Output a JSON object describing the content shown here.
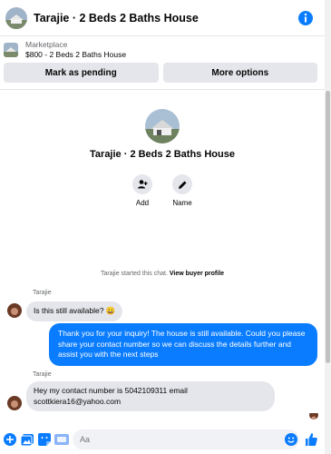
{
  "header": {
    "title": "Tarajie · 2 Beds 2 Baths House"
  },
  "listing": {
    "label": "Marketplace",
    "title": "$800 - 2 Beds 2 Baths House"
  },
  "actions": {
    "pending_label": "Mark as pending",
    "more_label": "More options"
  },
  "profile": {
    "title": "Tarajie · 2 Beds 2 Baths House",
    "add_label": "Add",
    "name_label": "Name"
  },
  "chat": {
    "started_prefix": "Tarajie started this chat.",
    "view_profile": "View buyer profile",
    "messages": [
      {
        "sender": "Tarajie",
        "text": "Is this still available? 😀"
      },
      {
        "sender": "",
        "text": "Thank you for your inquiry! The house is still available. Could you please share your contact number so we can discuss the details further and assist you with the next steps"
      },
      {
        "sender": "Tarajie",
        "text": "Hey my contact number is 5042109311 email scottkiera16@yahoo.com"
      }
    ]
  },
  "composer": {
    "placeholder": "Aa"
  },
  "colors": {
    "accent": "#0a7cff",
    "bubble_in": "#e4e6eb",
    "muted": "#65676b"
  },
  "icons": [
    "info-icon",
    "add-person-icon",
    "pencil-icon",
    "plus-icon",
    "photo-icon",
    "sticker-icon",
    "gif-icon",
    "emoji-icon",
    "like-icon"
  ]
}
